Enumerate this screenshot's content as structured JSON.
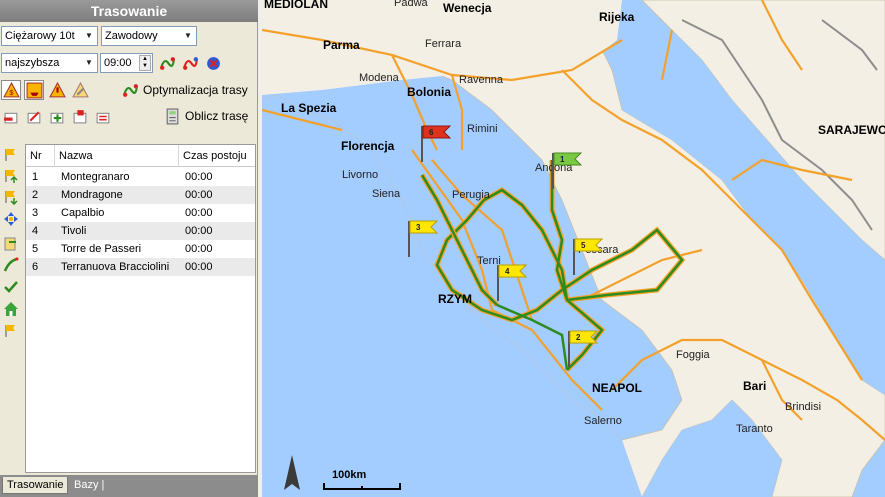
{
  "panel": {
    "title": "Trasowanie",
    "vehicle": "Ciężarowy 10t",
    "profile": "Zawodowy",
    "route_mode": "najszybsza",
    "time": "09:00",
    "optimize_label": "Optymalizacja trasy",
    "calculate_label": "Oblicz trasę"
  },
  "table": {
    "headers": {
      "nr": "Nr",
      "name": "Nazwa",
      "stop": "Czas postoju"
    },
    "rows": [
      {
        "nr": "1",
        "name": "Montegranaro",
        "stop": "00:00"
      },
      {
        "nr": "2",
        "name": "Mondragone",
        "stop": "00:00"
      },
      {
        "nr": "3",
        "name": "Capalbio",
        "stop": "00:00"
      },
      {
        "nr": "4",
        "name": "Tivoli",
        "stop": "00:00"
      },
      {
        "nr": "5",
        "name": "Torre de Passeri",
        "stop": "00:00"
      },
      {
        "nr": "6",
        "name": "Terranuova Bracciolini",
        "stop": "00:00"
      }
    ]
  },
  "tabs": {
    "routing": "Trasowanie",
    "bases": "Bazy |"
  },
  "map": {
    "cities": {
      "mediolan": "MEDIOLAN",
      "padwa": "Padwa",
      "wenecja": "Wenecja",
      "rijeka": "Rijeka",
      "parma": "Parma",
      "ferrara": "Ferrara",
      "modena": "Modena",
      "ravenna": "Ravenna",
      "bolonia": "Bolonia",
      "laspezia": "La Spezia",
      "florencja": "Florencja",
      "rimini": "Rimini",
      "livorno": "Livorno",
      "ancona": "Ancona",
      "siena": "Siena",
      "perugia": "Perugia",
      "pescara": "Pescara",
      "terni": "Terni",
      "rzym": "RZYM",
      "foggia": "Foggia",
      "bari": "Bari",
      "neapol": "NEAPOL",
      "salerno": "Salerno",
      "brindisi": "Brindisi",
      "taranto": "Taranto",
      "sarajewo": "SARAJEWO"
    },
    "flags": [
      "1",
      "2",
      "3",
      "4",
      "5",
      "6"
    ],
    "scale": "100km"
  },
  "colors": {
    "route_green": "#2e8b1e",
    "route_orange": "#f4a12c",
    "land": "#f3efe4",
    "sea": "#a3ccff",
    "flag_green": "#7ac943",
    "flag_yellow": "#ffe600",
    "flag_red": "#e0301e"
  }
}
